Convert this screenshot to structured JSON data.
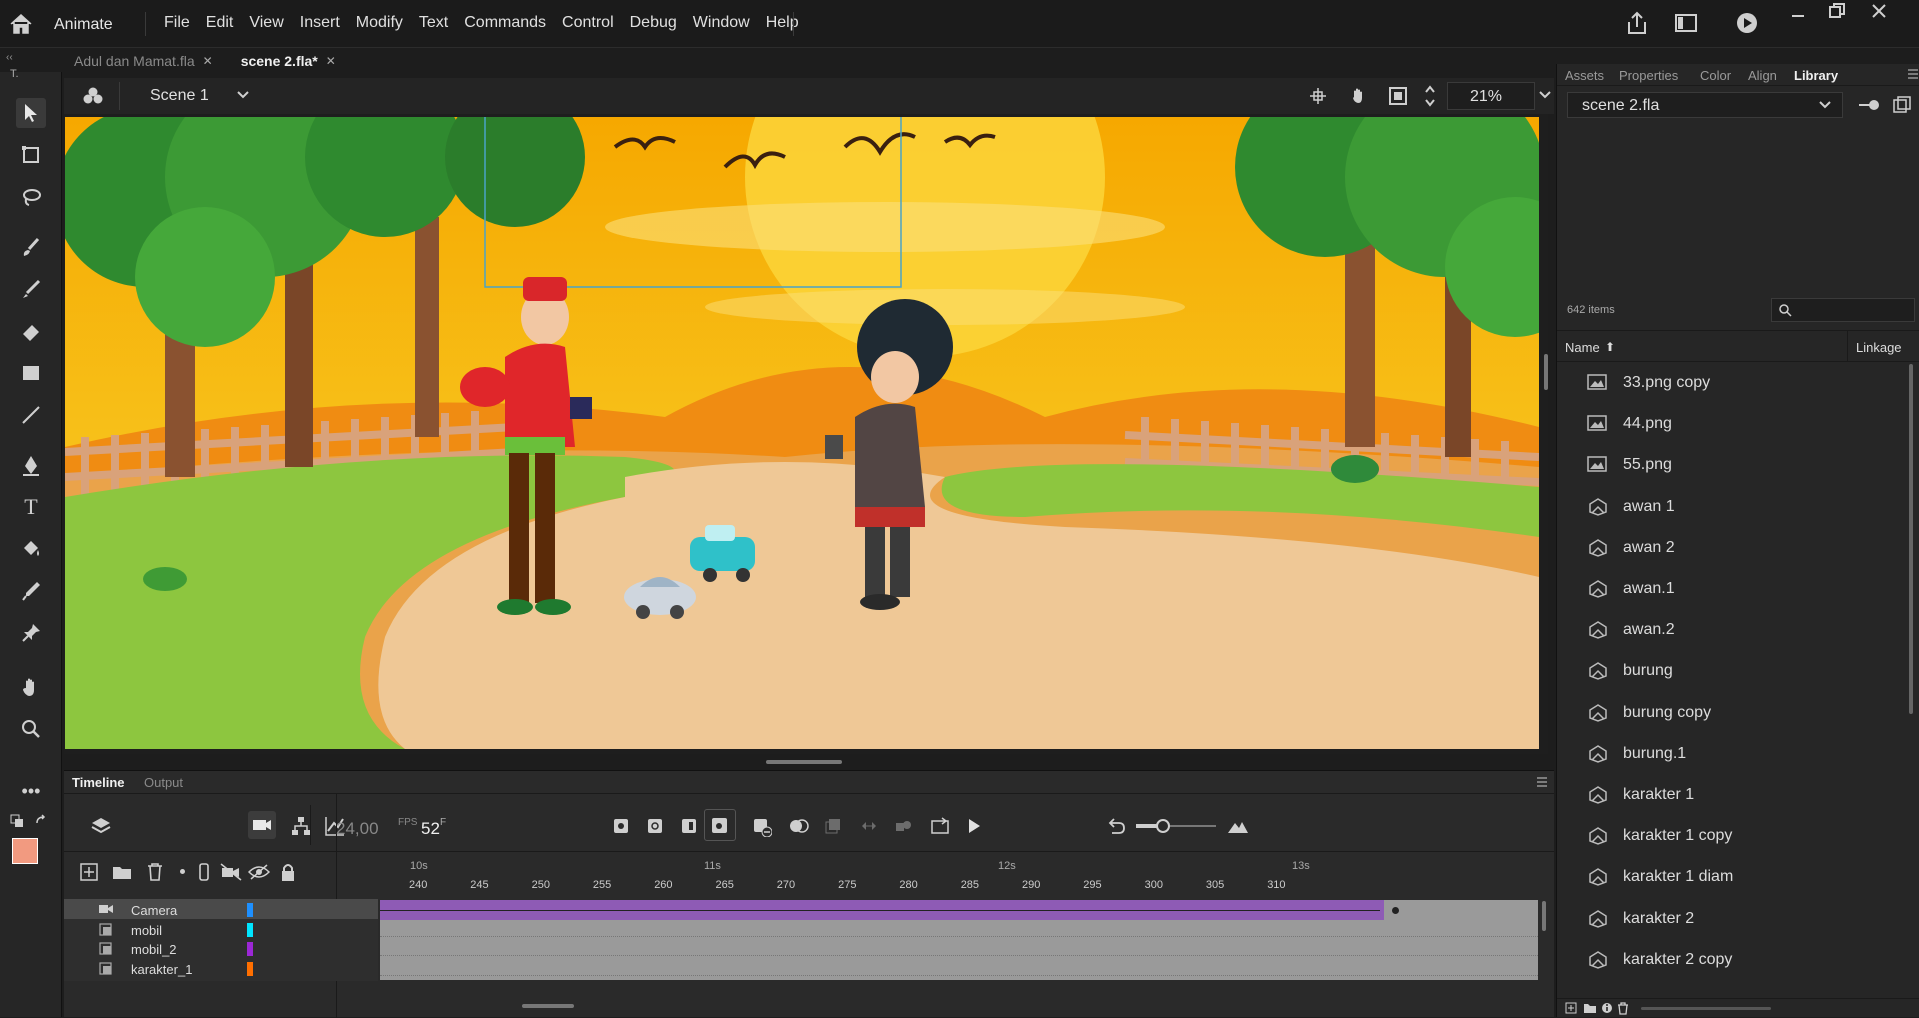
{
  "app": {
    "name": "Animate"
  },
  "menu": [
    "File",
    "Edit",
    "View",
    "Insert",
    "Modify",
    "Text",
    "Commands",
    "Control",
    "Debug",
    "Window",
    "Help"
  ],
  "doc_tabs": [
    {
      "label": "Adul dan Mamat.fla",
      "active": false
    },
    {
      "label": "scene 2.fla*",
      "active": true
    }
  ],
  "toolbox_label": "T.",
  "scene": {
    "name": "Scene 1",
    "zoom": "21%"
  },
  "timeline": {
    "tabs": [
      "Timeline",
      "Output"
    ],
    "fps": "24,00",
    "fps_unit": "FPS",
    "frame": "52",
    "frame_unit": "F",
    "time_markers": [
      "10s",
      "11s",
      "12s",
      "13s"
    ],
    "ruler": [
      "240",
      "245",
      "250",
      "255",
      "260",
      "265",
      "270",
      "275",
      "280",
      "285",
      "290",
      "295",
      "300",
      "305",
      "310"
    ],
    "layers": [
      {
        "name": "Camera",
        "color": "#1e90ff",
        "icon": "camera-icon"
      },
      {
        "name": "mobil",
        "color": "#00e5ff",
        "icon": "layer-icon"
      },
      {
        "name": "mobil_2",
        "color": "#9c27d6",
        "icon": "layer-icon"
      },
      {
        "name": "karakter_1",
        "color": "#ff6f00",
        "icon": "layer-icon"
      }
    ]
  },
  "right_panel": {
    "tabs": [
      "Assets",
      "Properties",
      "Color",
      "Align",
      "Library"
    ],
    "active_tab": "Library",
    "library_file": "scene 2.fla",
    "item_count": "642 items",
    "col_name": "Name",
    "col_linkage": "Linkage",
    "items": [
      {
        "label": "33.png copy",
        "icon": "bitmap-icon"
      },
      {
        "label": "44.png",
        "icon": "bitmap-icon"
      },
      {
        "label": "55.png",
        "icon": "bitmap-icon"
      },
      {
        "label": "awan 1",
        "icon": "symbol-icon"
      },
      {
        "label": "awan 2",
        "icon": "symbol-icon"
      },
      {
        "label": "awan.1",
        "icon": "symbol-icon"
      },
      {
        "label": "awan.2",
        "icon": "symbol-icon"
      },
      {
        "label": "burung",
        "icon": "symbol-icon"
      },
      {
        "label": "burung copy",
        "icon": "symbol-icon"
      },
      {
        "label": "burung.1",
        "icon": "symbol-icon"
      },
      {
        "label": "karakter 1",
        "icon": "symbol-icon"
      },
      {
        "label": "karakter 1 copy",
        "icon": "symbol-icon"
      },
      {
        "label": "karakter 1 diam",
        "icon": "symbol-icon"
      },
      {
        "label": "karakter 2",
        "icon": "symbol-icon"
      },
      {
        "label": "karakter 2 copy",
        "icon": "symbol-icon"
      }
    ]
  },
  "colors": {
    "accent": "#8e5bb5",
    "fill_swatch": "#f29a80",
    "bg": "#1d1d1d"
  }
}
